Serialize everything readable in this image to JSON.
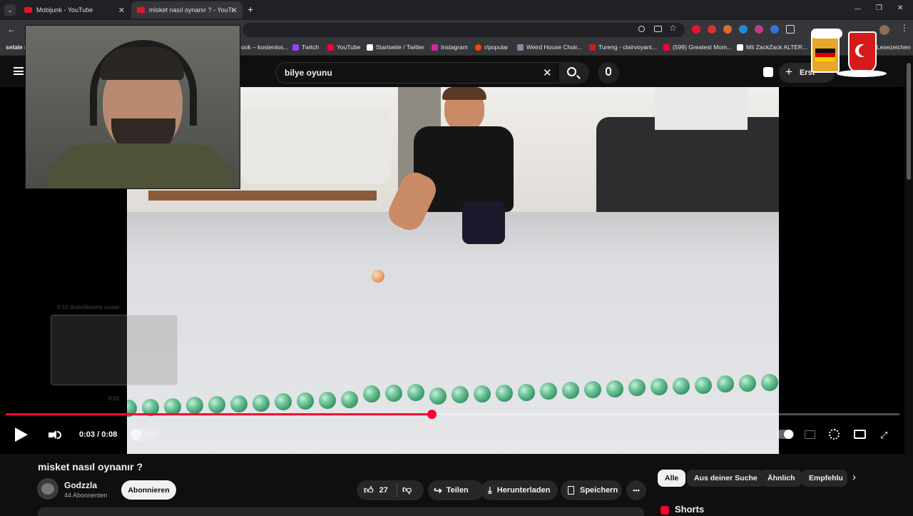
{
  "browser": {
    "tabs": [
      {
        "title": "Mobijunk - YouTube"
      },
      {
        "title": "misket nasıl oynanır ? - YouTube"
      }
    ],
    "new_tab_symbol": "+",
    "window_controls": [
      "—",
      "❐",
      "✕"
    ],
    "bookmarks": [
      {
        "label": "selale m",
        "color": "#35363a"
      },
      {
        "label": "ook – kostenlos...",
        "color": "#35363a"
      },
      {
        "label": "Twitch",
        "color": "#9146ff"
      },
      {
        "label": "YouTube",
        "color": "#ff0033"
      },
      {
        "label": "Startseite / Twitter",
        "color": "#ffffff"
      },
      {
        "label": "Instagram",
        "color": "#d6249f"
      },
      {
        "label": "r/popular",
        "color": "#ff4500"
      },
      {
        "label": "Weird House Choir...",
        "color": "#8888aa"
      },
      {
        "label": "Tureng - clairvoyant...",
        "color": "#c81e1e"
      },
      {
        "label": "(599) Greatest Mom...",
        "color": "#ff0033"
      },
      {
        "label": "Mit ZackZack ALTER...",
        "color": "#ffffff"
      },
      {
        "label": "Lesezeichen",
        "color": "#35363a"
      }
    ]
  },
  "youtube": {
    "search": {
      "value": "bilye oyunu"
    },
    "create_label": "Erst",
    "player": {
      "progress": 0.375,
      "time_current": "0:03",
      "time_separator": " / ",
      "time_total": "0:08",
      "toggle_label": "OFF",
      "preview_caption": "0:10 dsdsölkerere suuae",
      "preview_time": "0:01"
    },
    "video": {
      "title": "misket nasıl oynanır ?",
      "channel": "Godzzla",
      "subscribers": "44 Abonnenten",
      "subscribe_label": "Abonnieren",
      "likes": "27",
      "share_label": "Teilen",
      "download_label": "Herunterladen",
      "save_label": "Speichern",
      "more_label": "•••"
    },
    "chips": [
      "Alle",
      "Aus deiner Suche",
      "Ähnlich",
      "Empfehlu"
    ],
    "shorts_label": "Shorts"
  },
  "colors": {
    "accent": "#ff0033",
    "background": "#0f0f0f"
  }
}
